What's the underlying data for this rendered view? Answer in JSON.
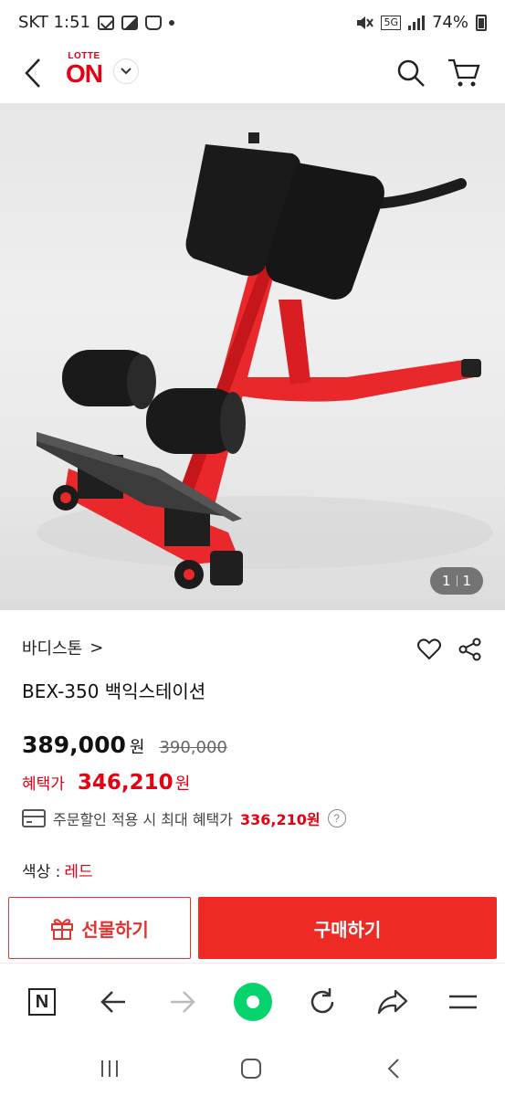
{
  "status_bar": {
    "carrier_time": "SKT 1:51",
    "network": "5G",
    "battery": "74%"
  },
  "header": {
    "logo_top": "LOTTE",
    "logo_main": "ON"
  },
  "product": {
    "image_counter_current": "1",
    "image_counter_total": "1",
    "brand": "바디스톤",
    "brand_chevron": ">",
    "title": "BEX-350 백익스테이션",
    "price": "389,000",
    "price_unit": "원",
    "original_price": "390,000",
    "benefit_label": "혜택가",
    "benefit_price": "346,210",
    "benefit_unit": "원",
    "card_discount_text": "주문할인 적용 시 최대 혜택가",
    "card_discount_price": "336,210원",
    "help_symbol": "?",
    "color_label": "색상 :",
    "color_value": "레드"
  },
  "actions": {
    "gift_label": "선물하기",
    "buy_label": "구매하기"
  },
  "browser_bar": {
    "naver_label": "N"
  },
  "colors": {
    "accent": "#e60012",
    "buy_button": "#ee2a24",
    "green": "#05d36d"
  }
}
